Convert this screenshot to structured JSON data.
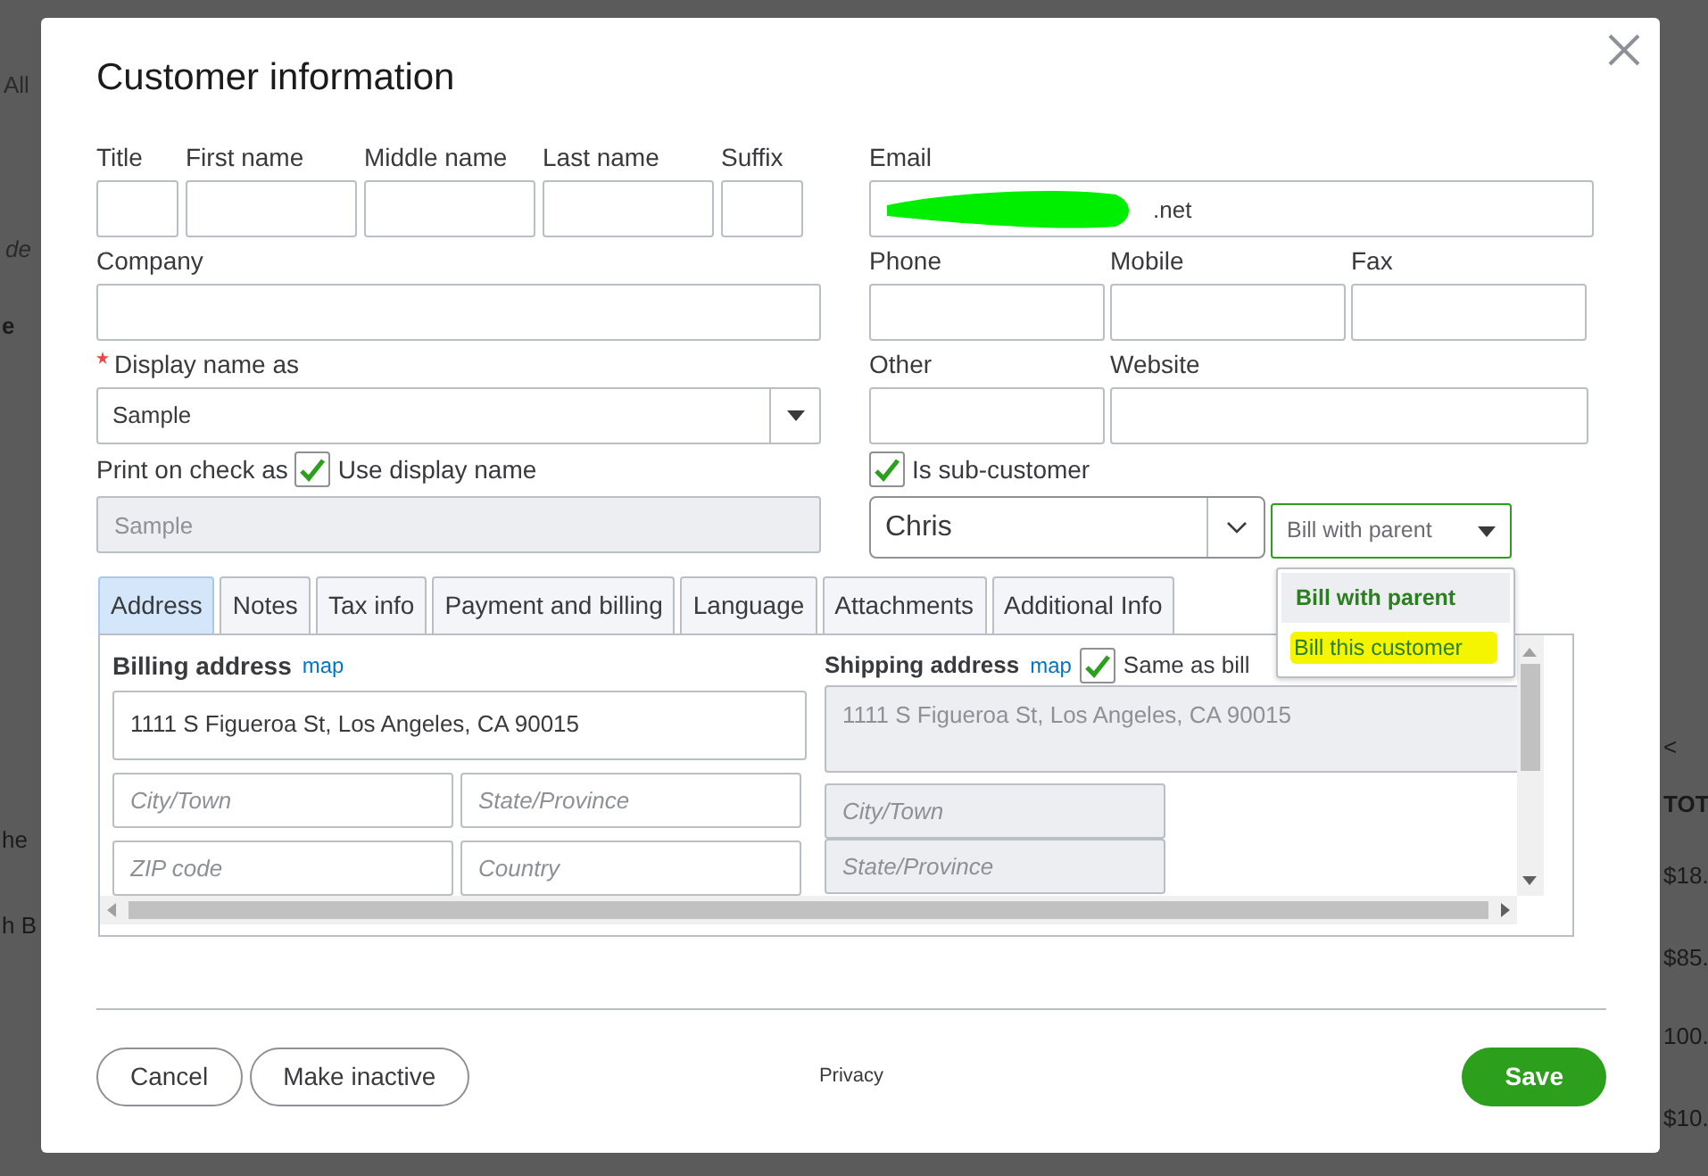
{
  "background": {
    "left_texts": [
      "All",
      "de",
      "e",
      "he",
      "h B"
    ],
    "right_texts": [
      "<",
      "TOT",
      "$18.",
      "$85.",
      "100.",
      "$10."
    ]
  },
  "dialog": {
    "title": "Customer information",
    "name_fields": [
      {
        "label": "Title"
      },
      {
        "label": "First name"
      },
      {
        "label": "Middle name"
      },
      {
        "label": "Last name"
      },
      {
        "label": "Suffix"
      }
    ],
    "company": {
      "label": "Company"
    },
    "display_name": {
      "label": "Display name as",
      "required": true,
      "value": "Sample"
    },
    "print_on_check": {
      "label": "Print on check as",
      "checkbox_label": "Use display name",
      "checked": true,
      "value": "Sample",
      "disabled": true
    },
    "email": {
      "label": "Email",
      "value": ".net",
      "redacted": true
    },
    "contact_fields": [
      {
        "label": "Phone"
      },
      {
        "label": "Mobile"
      },
      {
        "label": "Fax"
      }
    ],
    "other_fields": [
      {
        "label": "Other"
      },
      {
        "label": "Website"
      }
    ],
    "sub_customer": {
      "label": "Is sub-customer",
      "checked": true,
      "parent": "Chris",
      "billing": "Bill with parent",
      "expanded": true,
      "options": [
        {
          "label": "Bill with parent",
          "selected": true,
          "highlighted": false
        },
        {
          "label": "Bill this customer",
          "selected": false,
          "highlighted": true
        }
      ]
    },
    "tabs": [
      {
        "label": "Address",
        "selected": true
      },
      {
        "label": "Notes",
        "selected": false
      },
      {
        "label": "Tax info",
        "selected": false
      },
      {
        "label": "Payment and billing",
        "selected": false
      },
      {
        "label": "Language",
        "selected": false
      },
      {
        "label": "Attachments",
        "selected": false
      },
      {
        "label": "Additional Info",
        "selected": false
      }
    ],
    "billing_address": {
      "label": "Billing address",
      "link": "map",
      "street": "1111 S Figueroa St, Los Angeles, CA 90015",
      "placeholders": [
        "City/Town",
        "State/Province",
        "ZIP code",
        "Country"
      ]
    },
    "shipping_address": {
      "label": "Shipping address",
      "link": "map",
      "same_as_label": "Same as bill",
      "same_as_checked": true,
      "disabled": true,
      "street": "1111 S Figueroa St, Los Angeles, CA 90015",
      "placeholders": [
        "City/Town",
        "State/Province"
      ]
    },
    "footer": {
      "buttons": [
        {
          "label": "Cancel"
        },
        {
          "label": "Make inactive"
        }
      ],
      "privacy": "Privacy",
      "save": "Save"
    }
  }
}
